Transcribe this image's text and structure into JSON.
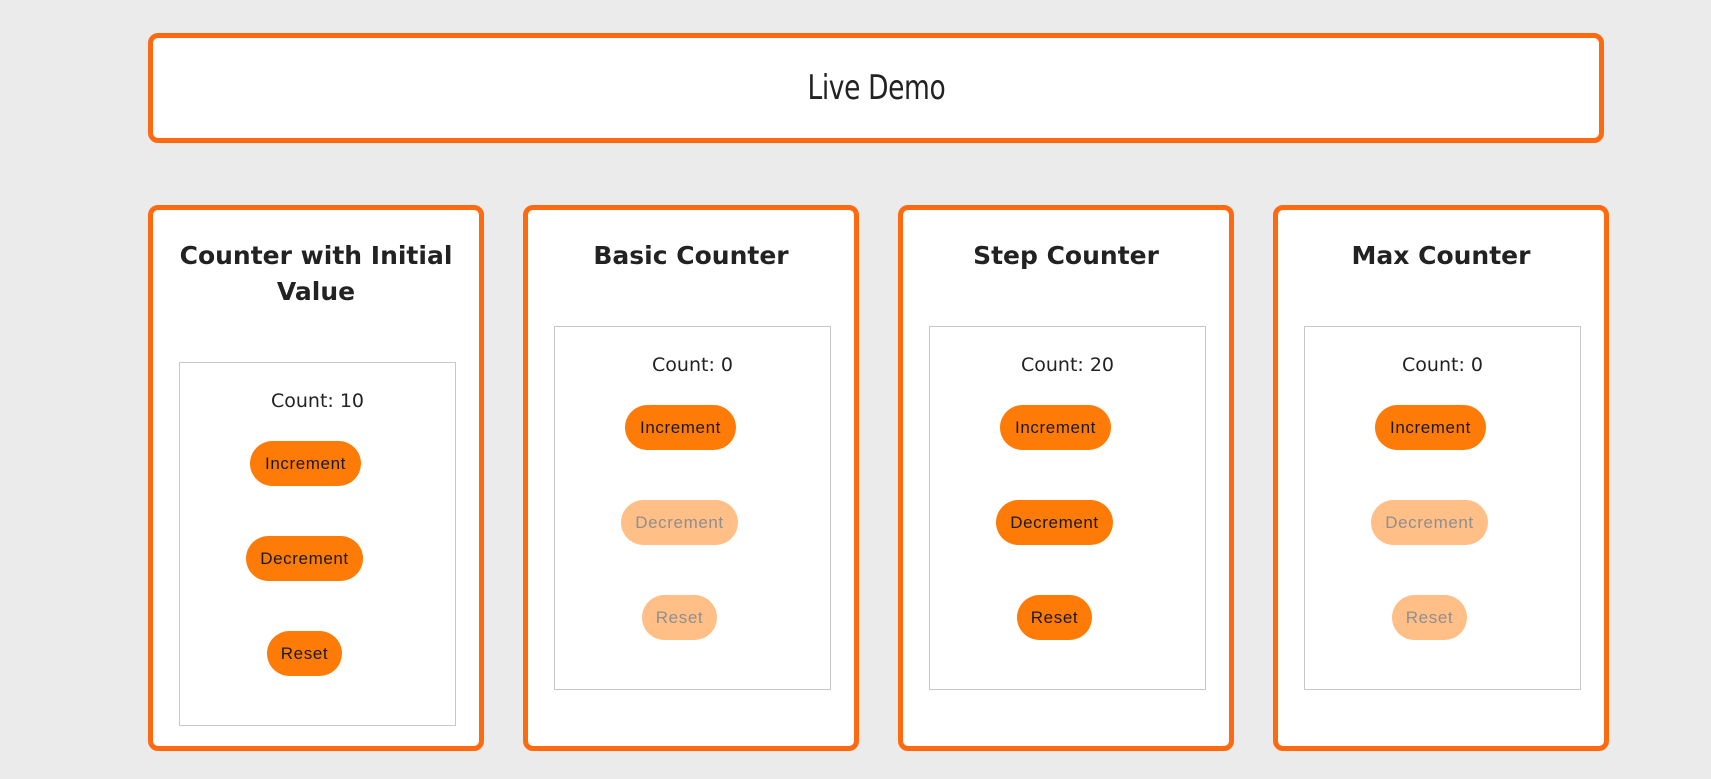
{
  "header": {
    "title": "Live Demo"
  },
  "cards": [
    {
      "title": "Counter with Initial Value",
      "count_text": "Count: 10",
      "increment_label": "Increment",
      "decrement_label": "Decrement",
      "reset_label": "Reset",
      "decrement_enabled": true,
      "reset_enabled": true
    },
    {
      "title": "Basic Counter",
      "count_text": "Count: 0",
      "increment_label": "Increment",
      "decrement_label": "Decrement",
      "reset_label": "Reset",
      "decrement_enabled": false,
      "reset_enabled": false
    },
    {
      "title": "Step Counter",
      "count_text": "Count: 20",
      "increment_label": "Increment",
      "decrement_label": "Decrement",
      "reset_label": "Reset",
      "decrement_enabled": true,
      "reset_enabled": true
    },
    {
      "title": "Max Counter",
      "count_text": "Count: 0",
      "increment_label": "Increment",
      "decrement_label": "Decrement",
      "reset_label": "Reset",
      "decrement_enabled": false,
      "reset_enabled": false
    }
  ],
  "colors": {
    "accent_border": "#ff6a10",
    "button_active": "#ff7b07",
    "button_disabled": "#ffbf87",
    "background": "#ebebeb"
  }
}
